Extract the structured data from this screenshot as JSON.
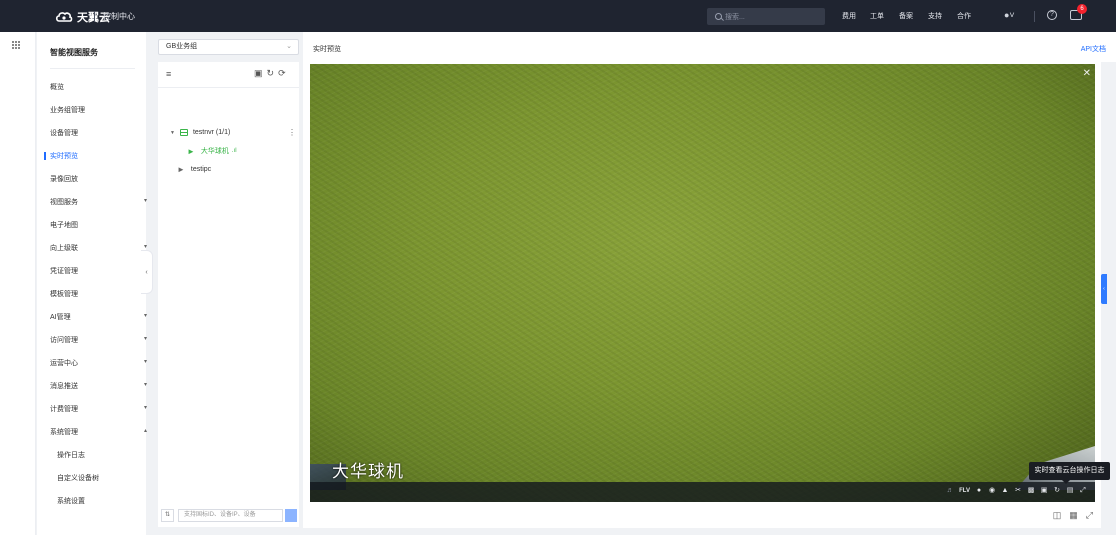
{
  "brand": {
    "name": "天翼云",
    "console": "控制中心"
  },
  "header": {
    "search_placeholder": "搜索...",
    "nav": [
      "费用",
      "工单",
      "备案",
      "支持",
      "合作"
    ],
    "user_icon": "user-icon",
    "help_icon": "help-icon",
    "message_count": "6"
  },
  "sidebar": {
    "title": "智能视图服务",
    "items": [
      {
        "label": "概览"
      },
      {
        "label": "业务组管理"
      },
      {
        "label": "设备管理"
      },
      {
        "label": "实时预览"
      },
      {
        "label": "录像回放"
      },
      {
        "label": "视图服务"
      },
      {
        "label": "电子地图"
      },
      {
        "label": "向上级联"
      },
      {
        "label": "凭证管理"
      },
      {
        "label": "模板管理"
      },
      {
        "label": "AI管理"
      },
      {
        "label": "访问管理"
      },
      {
        "label": "运营中心"
      },
      {
        "label": "消息推送"
      },
      {
        "label": "计费管理"
      },
      {
        "label": "系统管理"
      }
    ],
    "subitems": [
      {
        "label": "操作日志"
      },
      {
        "label": "自定义设备树"
      },
      {
        "label": "系统设置"
      }
    ]
  },
  "device_panel": {
    "group_select": "GB业务组",
    "tree": {
      "nvr": {
        "label": "testnvr (1/1)"
      },
      "nvr_child": {
        "label": "大华球机"
      },
      "ipc": {
        "label": "testipc"
      }
    },
    "search_placeholder": "支持国标ID、设备IP、设备"
  },
  "main": {
    "title": "实时预览",
    "api_link": "API文档",
    "video_overlay": "大华球机",
    "stream_format": "FLV",
    "tooltip": "实时查看云台操作日志"
  },
  "colors": {
    "accent": "#1f6cff",
    "topbar": "#1f2430",
    "online": "#3bb54a"
  }
}
